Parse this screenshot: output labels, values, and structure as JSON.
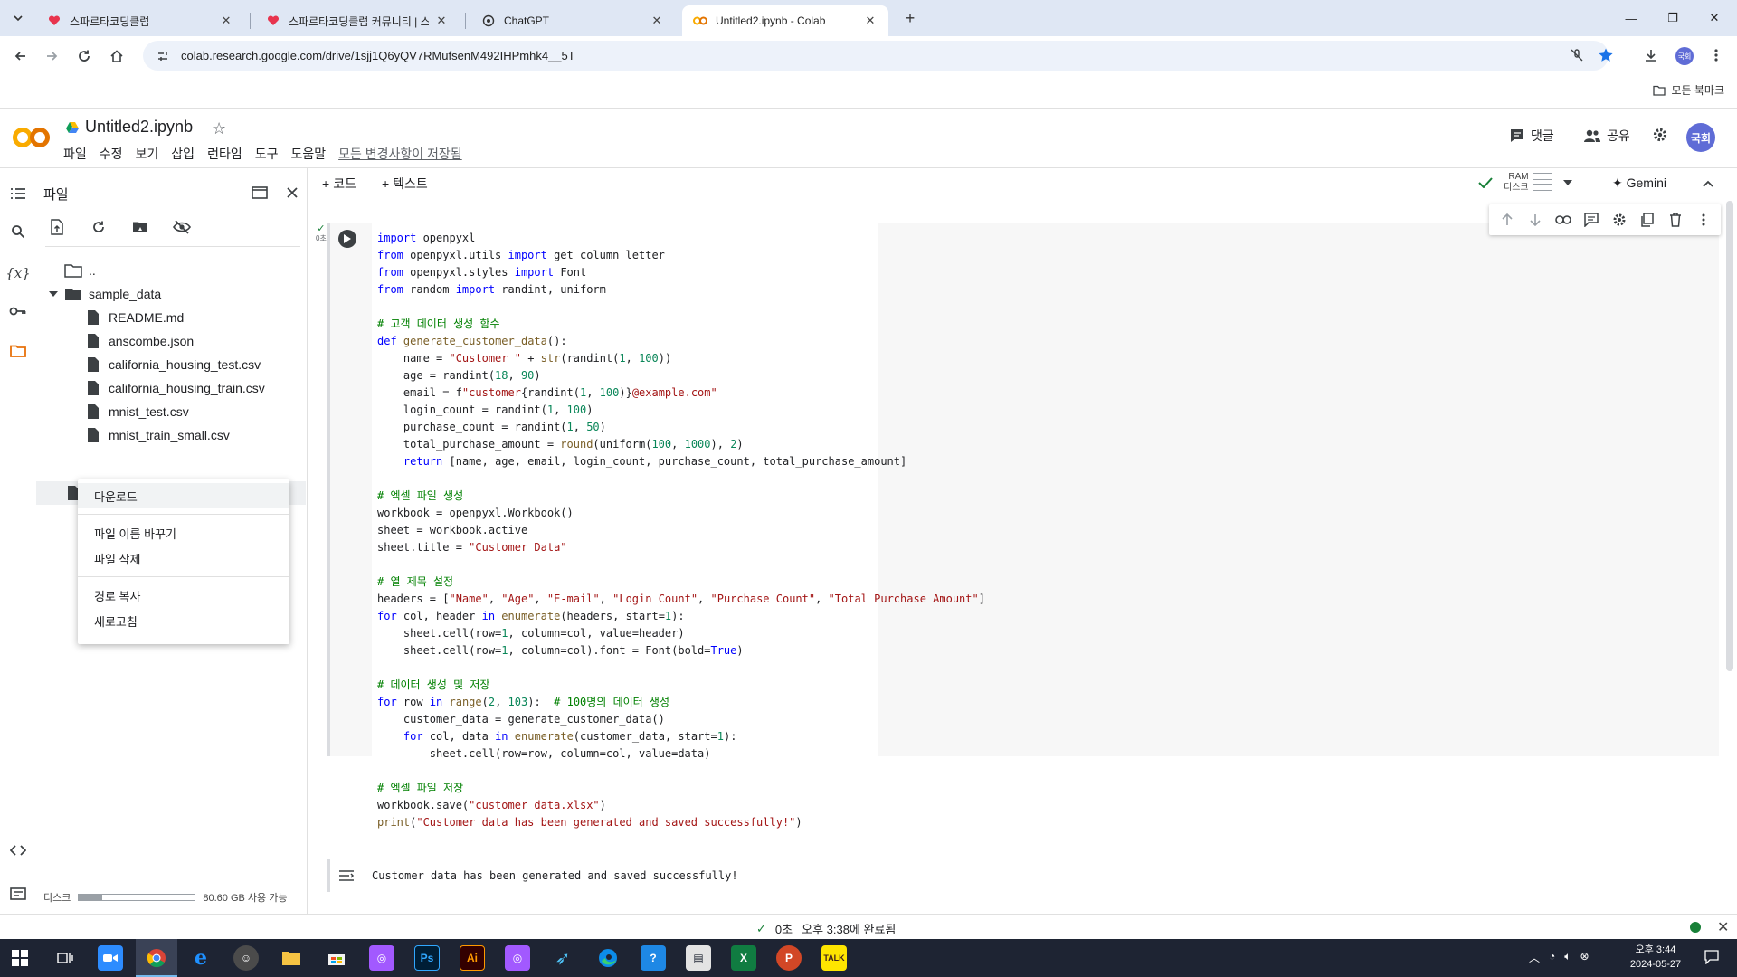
{
  "browser": {
    "tabs": [
      {
        "title": "스파르타코딩클럽",
        "active": false
      },
      {
        "title": "스파르타코딩클럽 커뮤니티 | 스",
        "active": false
      },
      {
        "title": "ChatGPT",
        "active": false
      },
      {
        "title": "Untitled2.ipynb - Colab",
        "active": true
      }
    ],
    "url": "colab.research.google.com/drive/1sjj1Q6yQV7RMufsenM492IHPmhk4__5T",
    "profile_initials": "국회",
    "bookmarks_all": "모든 북마크"
  },
  "colab": {
    "logo": "CO",
    "notebook_title": "Untitled2.ipynb",
    "menu": [
      "파일",
      "수정",
      "보기",
      "삽입",
      "런타임",
      "도구",
      "도움말"
    ],
    "save_status": "모든 변경사항이 저장됨",
    "comment_label": "댓글",
    "share_label": "공유",
    "avatar": "국회"
  },
  "files_panel": {
    "title": "파일",
    "tree": [
      {
        "label": "..",
        "type": "folder-up",
        "indent": 0
      },
      {
        "label": "sample_data",
        "type": "folder",
        "indent": 0
      },
      {
        "label": "README.md",
        "type": "file",
        "indent": 1
      },
      {
        "label": "anscombe.json",
        "type": "file",
        "indent": 1
      },
      {
        "label": "california_housing_test.csv",
        "type": "file",
        "indent": 1
      },
      {
        "label": "california_housing_train.csv",
        "type": "file",
        "indent": 1
      },
      {
        "label": "mnist_test.csv",
        "type": "file",
        "indent": 1
      },
      {
        "label": "mnist_train_small.csv",
        "type": "file",
        "indent": 1
      }
    ],
    "disk_label": "디스크",
    "disk_available": "80.60 GB 사용 가능",
    "disk_used_fraction": 0.2
  },
  "context_menu": {
    "download": "다운로드",
    "rename": "파일 이름 바꾸기",
    "delete": "파일 삭제",
    "copy_path": "경로 복사",
    "refresh": "새로고침"
  },
  "toolbar": {
    "add_code": "코드",
    "add_text": "텍스트",
    "ram_label": "RAM",
    "disk_label": "디스크",
    "gemini": "Gemini"
  },
  "cell": {
    "exec_time": "0초",
    "code_lines": [
      [
        [
          "kw",
          "import"
        ],
        [
          "p",
          " openpyxl"
        ]
      ],
      [
        [
          "kw",
          "from"
        ],
        [
          "p",
          " openpyxl.utils "
        ],
        [
          "kw",
          "import"
        ],
        [
          "p",
          " get_column_letter"
        ]
      ],
      [
        [
          "kw",
          "from"
        ],
        [
          "p",
          " openpyxl.styles "
        ],
        [
          "kw",
          "import"
        ],
        [
          "p",
          " Font"
        ]
      ],
      [
        [
          "kw",
          "from"
        ],
        [
          "p",
          " random "
        ],
        [
          "kw",
          "import"
        ],
        [
          "p",
          " randint, uniform"
        ]
      ],
      [
        [
          "p",
          ""
        ]
      ],
      [
        [
          "cm",
          "# 고객 데이터 생성 함수"
        ]
      ],
      [
        [
          "kw",
          "def"
        ],
        [
          "p",
          " "
        ],
        [
          "fn",
          "generate_customer_data"
        ],
        [
          "p",
          "():"
        ]
      ],
      [
        [
          "p",
          "    name = "
        ],
        [
          "st",
          "\"Customer \""
        ],
        [
          "p",
          " + "
        ],
        [
          "fn",
          "str"
        ],
        [
          "p",
          "(randint("
        ],
        [
          "nu",
          "1"
        ],
        [
          "p",
          ", "
        ],
        [
          "nu",
          "100"
        ],
        [
          "p",
          "))"
        ]
      ],
      [
        [
          "p",
          "    age = randint("
        ],
        [
          "nu",
          "18"
        ],
        [
          "p",
          ", "
        ],
        [
          "nu",
          "90"
        ],
        [
          "p",
          ")"
        ]
      ],
      [
        [
          "p",
          "    email = f"
        ],
        [
          "st",
          "\"customer"
        ],
        [
          "p",
          "{randint("
        ],
        [
          "nu",
          "1"
        ],
        [
          "p",
          ", "
        ],
        [
          "nu",
          "100"
        ],
        [
          "p",
          ")}"
        ],
        [
          "st",
          "@example.com\""
        ]
      ],
      [
        [
          "p",
          "    login_count = randint("
        ],
        [
          "nu",
          "1"
        ],
        [
          "p",
          ", "
        ],
        [
          "nu",
          "100"
        ],
        [
          "p",
          ")"
        ]
      ],
      [
        [
          "p",
          "    purchase_count = randint("
        ],
        [
          "nu",
          "1"
        ],
        [
          "p",
          ", "
        ],
        [
          "nu",
          "50"
        ],
        [
          "p",
          ")"
        ]
      ],
      [
        [
          "p",
          "    total_purchase_amount = "
        ],
        [
          "fn",
          "round"
        ],
        [
          "p",
          "(uniform("
        ],
        [
          "nu",
          "100"
        ],
        [
          "p",
          ", "
        ],
        [
          "nu",
          "1000"
        ],
        [
          "p",
          "), "
        ],
        [
          "nu",
          "2"
        ],
        [
          "p",
          ")"
        ]
      ],
      [
        [
          "p",
          "    "
        ],
        [
          "kw",
          "return"
        ],
        [
          "p",
          " [name, age, email, login_count, purchase_count, total_purchase_amount]"
        ]
      ],
      [
        [
          "p",
          ""
        ]
      ],
      [
        [
          "cm",
          "# 엑셀 파일 생성"
        ]
      ],
      [
        [
          "p",
          "workbook = openpyxl.Workbook()"
        ]
      ],
      [
        [
          "p",
          "sheet = workbook.active"
        ]
      ],
      [
        [
          "p",
          "sheet.title = "
        ],
        [
          "st",
          "\"Customer Data\""
        ]
      ],
      [
        [
          "p",
          ""
        ]
      ],
      [
        [
          "cm",
          "# 열 제목 설정"
        ]
      ],
      [
        [
          "p",
          "headers = ["
        ],
        [
          "st",
          "\"Name\""
        ],
        [
          "p",
          ", "
        ],
        [
          "st",
          "\"Age\""
        ],
        [
          "p",
          ", "
        ],
        [
          "st",
          "\"E-mail\""
        ],
        [
          "p",
          ", "
        ],
        [
          "st",
          "\"Login Count\""
        ],
        [
          "p",
          ", "
        ],
        [
          "st",
          "\"Purchase Count\""
        ],
        [
          "p",
          ", "
        ],
        [
          "st",
          "\"Total Purchase Amount\""
        ],
        [
          "p",
          "]"
        ]
      ],
      [
        [
          "kw",
          "for"
        ],
        [
          "p",
          " col, header "
        ],
        [
          "kw",
          "in"
        ],
        [
          "p",
          " "
        ],
        [
          "fn",
          "enumerate"
        ],
        [
          "p",
          "(headers, start="
        ],
        [
          "nu",
          "1"
        ],
        [
          "p",
          "):"
        ]
      ],
      [
        [
          "p",
          "    sheet.cell(row="
        ],
        [
          "nu",
          "1"
        ],
        [
          "p",
          ", column=col, value=header)"
        ]
      ],
      [
        [
          "p",
          "    sheet.cell(row="
        ],
        [
          "nu",
          "1"
        ],
        [
          "p",
          ", column=col).font = Font(bold="
        ],
        [
          "kw",
          "True"
        ],
        [
          "p",
          ")"
        ]
      ],
      [
        [
          "p",
          ""
        ]
      ],
      [
        [
          "cm",
          "# 데이터 생성 및 저장"
        ]
      ],
      [
        [
          "kw",
          "for"
        ],
        [
          "p",
          " row "
        ],
        [
          "kw",
          "in"
        ],
        [
          "p",
          " "
        ],
        [
          "fn",
          "range"
        ],
        [
          "p",
          "("
        ],
        [
          "nu",
          "2"
        ],
        [
          "p",
          ", "
        ],
        [
          "nu",
          "103"
        ],
        [
          "p",
          "):  "
        ],
        [
          "cm",
          "# 100명의 데이터 생성"
        ]
      ],
      [
        [
          "p",
          "    customer_data = generate_customer_data()"
        ]
      ],
      [
        [
          "p",
          "    "
        ],
        [
          "kw",
          "for"
        ],
        [
          "p",
          " col, data "
        ],
        [
          "kw",
          "in"
        ],
        [
          "p",
          " "
        ],
        [
          "fn",
          "enumerate"
        ],
        [
          "p",
          "(customer_data, start="
        ],
        [
          "nu",
          "1"
        ],
        [
          "p",
          "):"
        ]
      ],
      [
        [
          "p",
          "        sheet.cell(row=row, column=col, value=data)"
        ]
      ],
      [
        [
          "p",
          ""
        ]
      ],
      [
        [
          "cm",
          "# 엑셀 파일 저장"
        ]
      ],
      [
        [
          "p",
          "workbook.save("
        ],
        [
          "st",
          "\"customer_data.xlsx\""
        ],
        [
          "p",
          ")"
        ]
      ],
      [
        [
          "fn",
          "print"
        ],
        [
          "p",
          "("
        ],
        [
          "st",
          "\"Customer data has been generated and saved successfully!\""
        ],
        [
          "p",
          ")"
        ]
      ]
    ],
    "output": "Customer data has been generated and saved successfully!"
  },
  "statusbar": {
    "exec_time": "0초",
    "completed": "오후 3:38에 완료됨"
  },
  "taskbar": {
    "time": "오후 3:44",
    "date": "2024-05-27"
  },
  "colors": {
    "kw": "#0000ff",
    "st": "#a31515",
    "cm": "#008000",
    "nu": "#098658",
    "fn": "#795e26",
    "p": "#202124",
    "accent": "#f9ab00"
  }
}
